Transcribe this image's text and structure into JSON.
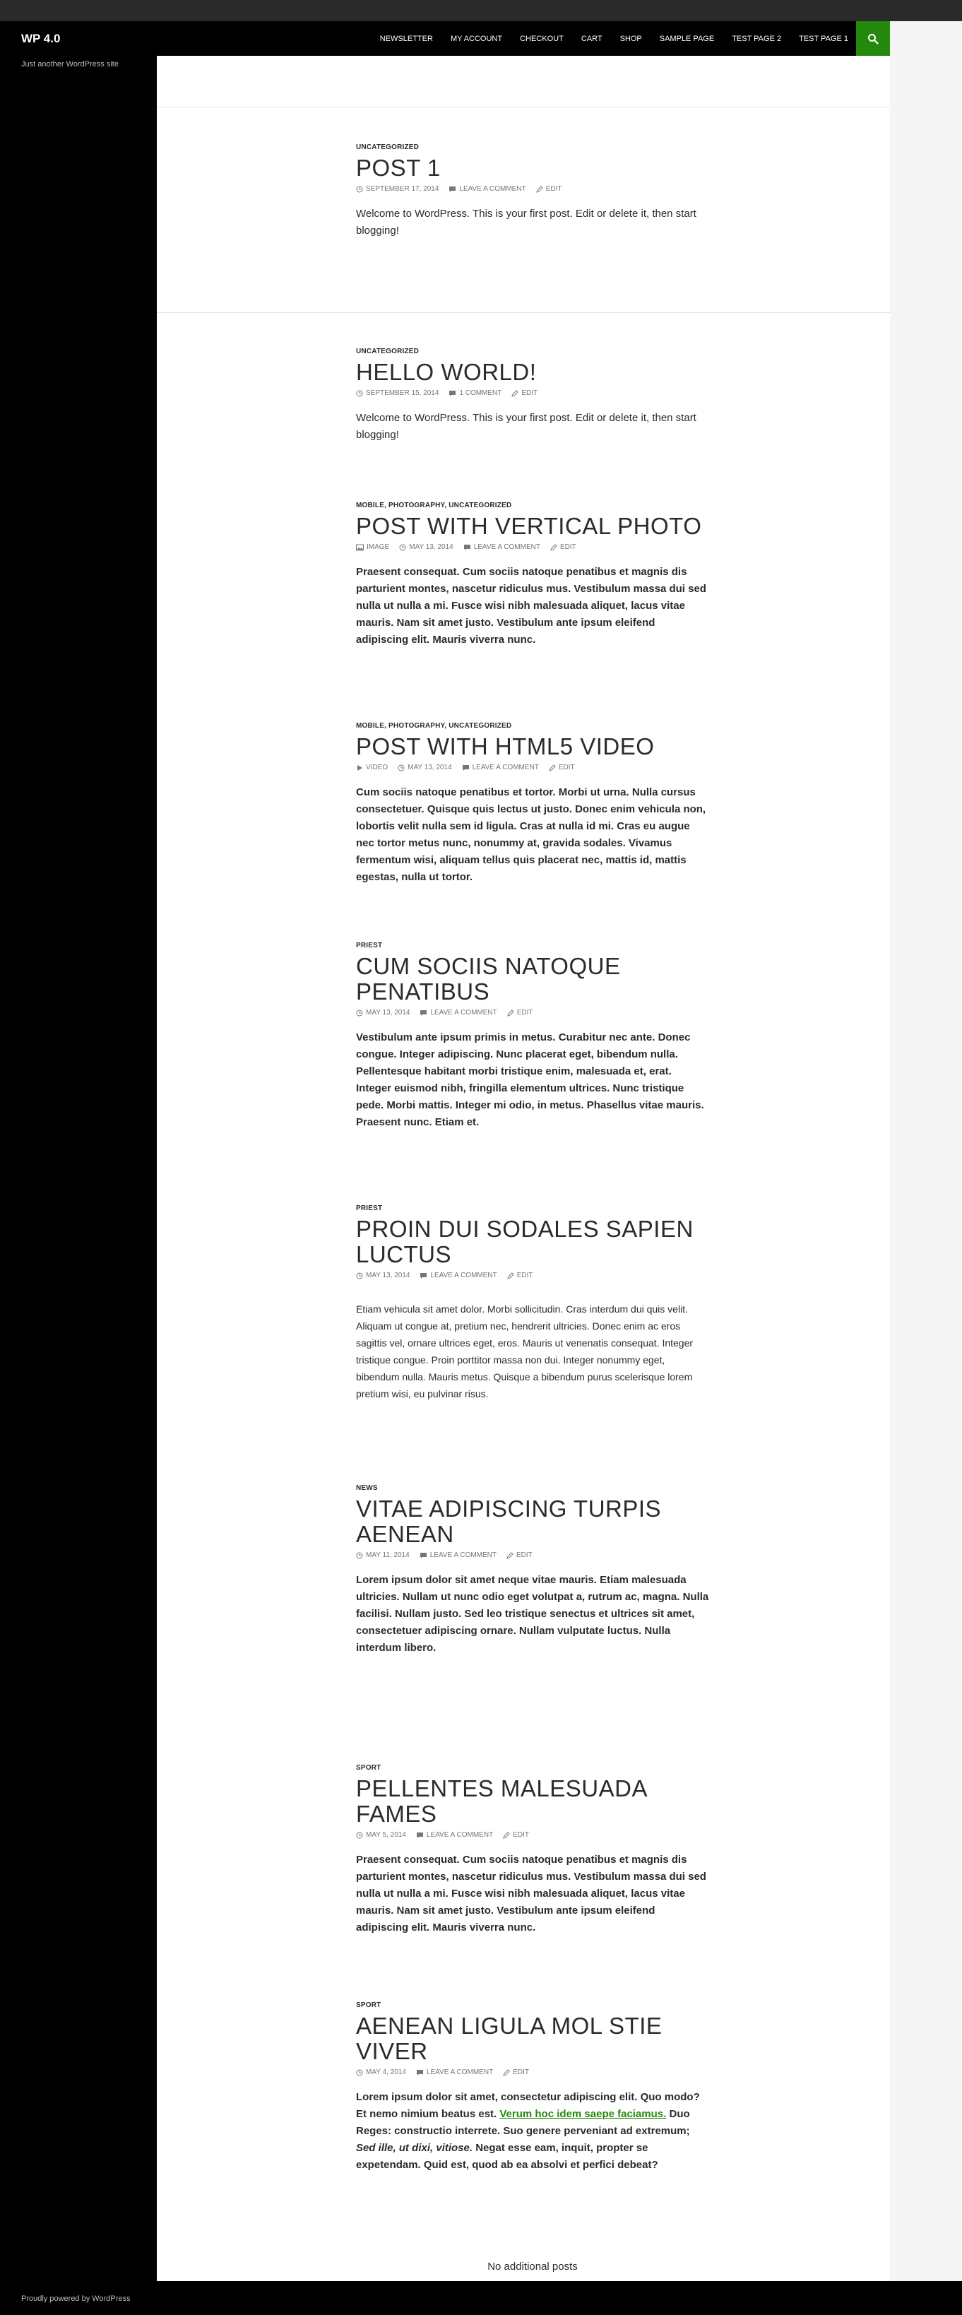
{
  "header": {
    "site_title": "WP 4.0",
    "tagline": "Just another WordPress site",
    "nav": [
      "NEWSLETTER",
      "MY ACCOUNT",
      "CHECKOUT",
      "CART",
      "SHOP",
      "SAMPLE PAGE",
      "TEST PAGE 2",
      "TEST PAGE 1"
    ]
  },
  "colors": {
    "accent": "#24890d",
    "sidebar": "#000000",
    "text": "#2b2b2b",
    "meta": "#767676"
  },
  "posts": [
    {
      "cats": "UNCATEGORIZED",
      "title": "POST 1",
      "date": "SEPTEMBER 17, 2014",
      "comments": "LEAVE A COMMENT",
      "edit": "EDIT",
      "excerpt": "Welcome to WordPress. This is your first post. Edit or delete it, then start blogging!"
    },
    {
      "cats": "UNCATEGORIZED",
      "title": "HELLO WORLD!",
      "date": "SEPTEMBER 15, 2014",
      "comments": "1 COMMENT",
      "edit": "EDIT",
      "excerpt": "Welcome to WordPress. This is your first post. Edit or delete it, then start blogging!"
    },
    {
      "cats": "MOBILE, PHOTOGRAPHY, UNCATEGORIZED",
      "title": "POST WITH VERTICAL PHOTO",
      "format": "IMAGE",
      "date": "MAY 13, 2014",
      "comments": "LEAVE A COMMENT",
      "edit": "EDIT",
      "excerpt": "Praesent consequat. Cum sociis natoque penatibus et magnis dis parturient montes, nascetur ridiculus mus. Vestibulum massa dui sed nulla ut nulla a mi. Fusce wisi nibh malesuada aliquet, lacus vitae mauris. Nam sit amet justo. Vestibulum ante ipsum eleifend adipiscing elit. Mauris viverra nunc."
    },
    {
      "cats": "MOBILE, PHOTOGRAPHY, UNCATEGORIZED",
      "title": "POST WITH HTML5 VIDEO",
      "format": "VIDEO",
      "date": "MAY 13, 2014",
      "comments": "LEAVE A COMMENT",
      "edit": "EDIT",
      "excerpt": "Cum sociis natoque penatibus et tortor. Morbi ut urna. Nulla cursus consectetuer. Quisque quis lectus ut justo. Donec enim vehicula non, lobortis velit nulla sem id ligula. Cras at nulla id mi. Cras eu augue nec tortor metus nunc, nonummy at, gravida sodales. Vivamus fermentum wisi, aliquam tellus quis placerat nec, mattis id, mattis egestas, nulla ut tortor."
    },
    {
      "cats": "PRIEST",
      "title": "CUM SOCIIS NATOQUE PENATIBUS",
      "date": "MAY 13, 2014",
      "comments": "LEAVE A COMMENT",
      "edit": "EDIT",
      "excerpt": "Vestibulum ante ipsum primis in metus. Curabitur nec ante. Donec congue. Integer adipiscing. Nunc placerat eget, bibendum nulla. Pellentesque habitant morbi tristique enim, malesuada et, erat. Integer euismod nibh, fringilla elementum ultrices. Nunc tristique pede. Morbi mattis. Integer mi odio, in metus. Phasellus vitae mauris. Praesent nunc. Etiam et."
    },
    {
      "cats": "PRIEST",
      "title": "PROIN DUI SODALES SAPIEN LUCTUS",
      "date": "MAY 13, 2014",
      "comments": "LEAVE A COMMENT",
      "edit": "EDIT",
      "excerpt": "Etiam vehicula sit amet dolor. Morbi sollicitudin. Cras interdum dui quis velit. Aliquam ut congue at, pretium nec, hendrerit ultricies. Donec enim ac eros sagittis vel, ornare ultrices eget, eros. Mauris ut venenatis consequat. Integer tristique congue. Proin porttitor massa non dui. Integer nonummy eget, bibendum nulla. Mauris metus. Quisque a bibendum purus scelerisque lorem pretium wisi, eu pulvinar risus."
    },
    {
      "cats": "NEWS",
      "title": "VITAE ADIPISCING TURPIS AENEAN",
      "date": "MAY 11, 2014",
      "comments": "LEAVE A COMMENT",
      "edit": "EDIT",
      "excerpt": "Lorem ipsum dolor sit amet neque vitae mauris. Etiam malesuada ultricies. Nullam ut nunc odio eget volutpat a, rutrum ac, magna. Nulla facilisi. Nullam justo. Sed leo tristique senectus et ultrices sit amet, consectetuer adipiscing ornare. Nullam vulputate luctus. Nulla interdum libero."
    },
    {
      "cats": "SPORT",
      "title": "PELLENTES MALESUADA FAMES",
      "date": "MAY 5, 2014",
      "comments": "LEAVE A COMMENT",
      "edit": "EDIT",
      "excerpt": "Praesent consequat. Cum sociis natoque penatibus et magnis dis parturient montes, nascetur ridiculus mus. Vestibulum massa dui sed nulla ut nulla a mi. Fusce wisi nibh malesuada aliquet, lacus vitae mauris. Nam sit amet justo. Vestibulum ante ipsum eleifend adipiscing elit. Mauris viverra nunc."
    },
    {
      "cats": "SPORT",
      "title": "AENEAN LIGULA MOL STIE VIVER",
      "date": "MAY 4, 2014",
      "comments": "LEAVE A COMMENT",
      "edit": "EDIT",
      "excerpt_a": "Lorem ipsum dolor sit amet, consectetur adipiscing elit. Quo modo? Et nemo nimium beatus est. ",
      "excerpt_link": "Verum hoc idem saepe faciamus.",
      "excerpt_b": " Duo Reges: constructio interrete. Suo genere perveniant ad extremum; ",
      "excerpt_em": "Sed ille, ut dixi, vitiose.",
      "excerpt_c": " Negat esse eam, inquit, propter se expetendam. Quid est, quod ab ea absolvi et perfici debeat?"
    }
  ],
  "pagination": "No additional posts",
  "footer": {
    "credit": "Proudly powered by WordPress"
  }
}
